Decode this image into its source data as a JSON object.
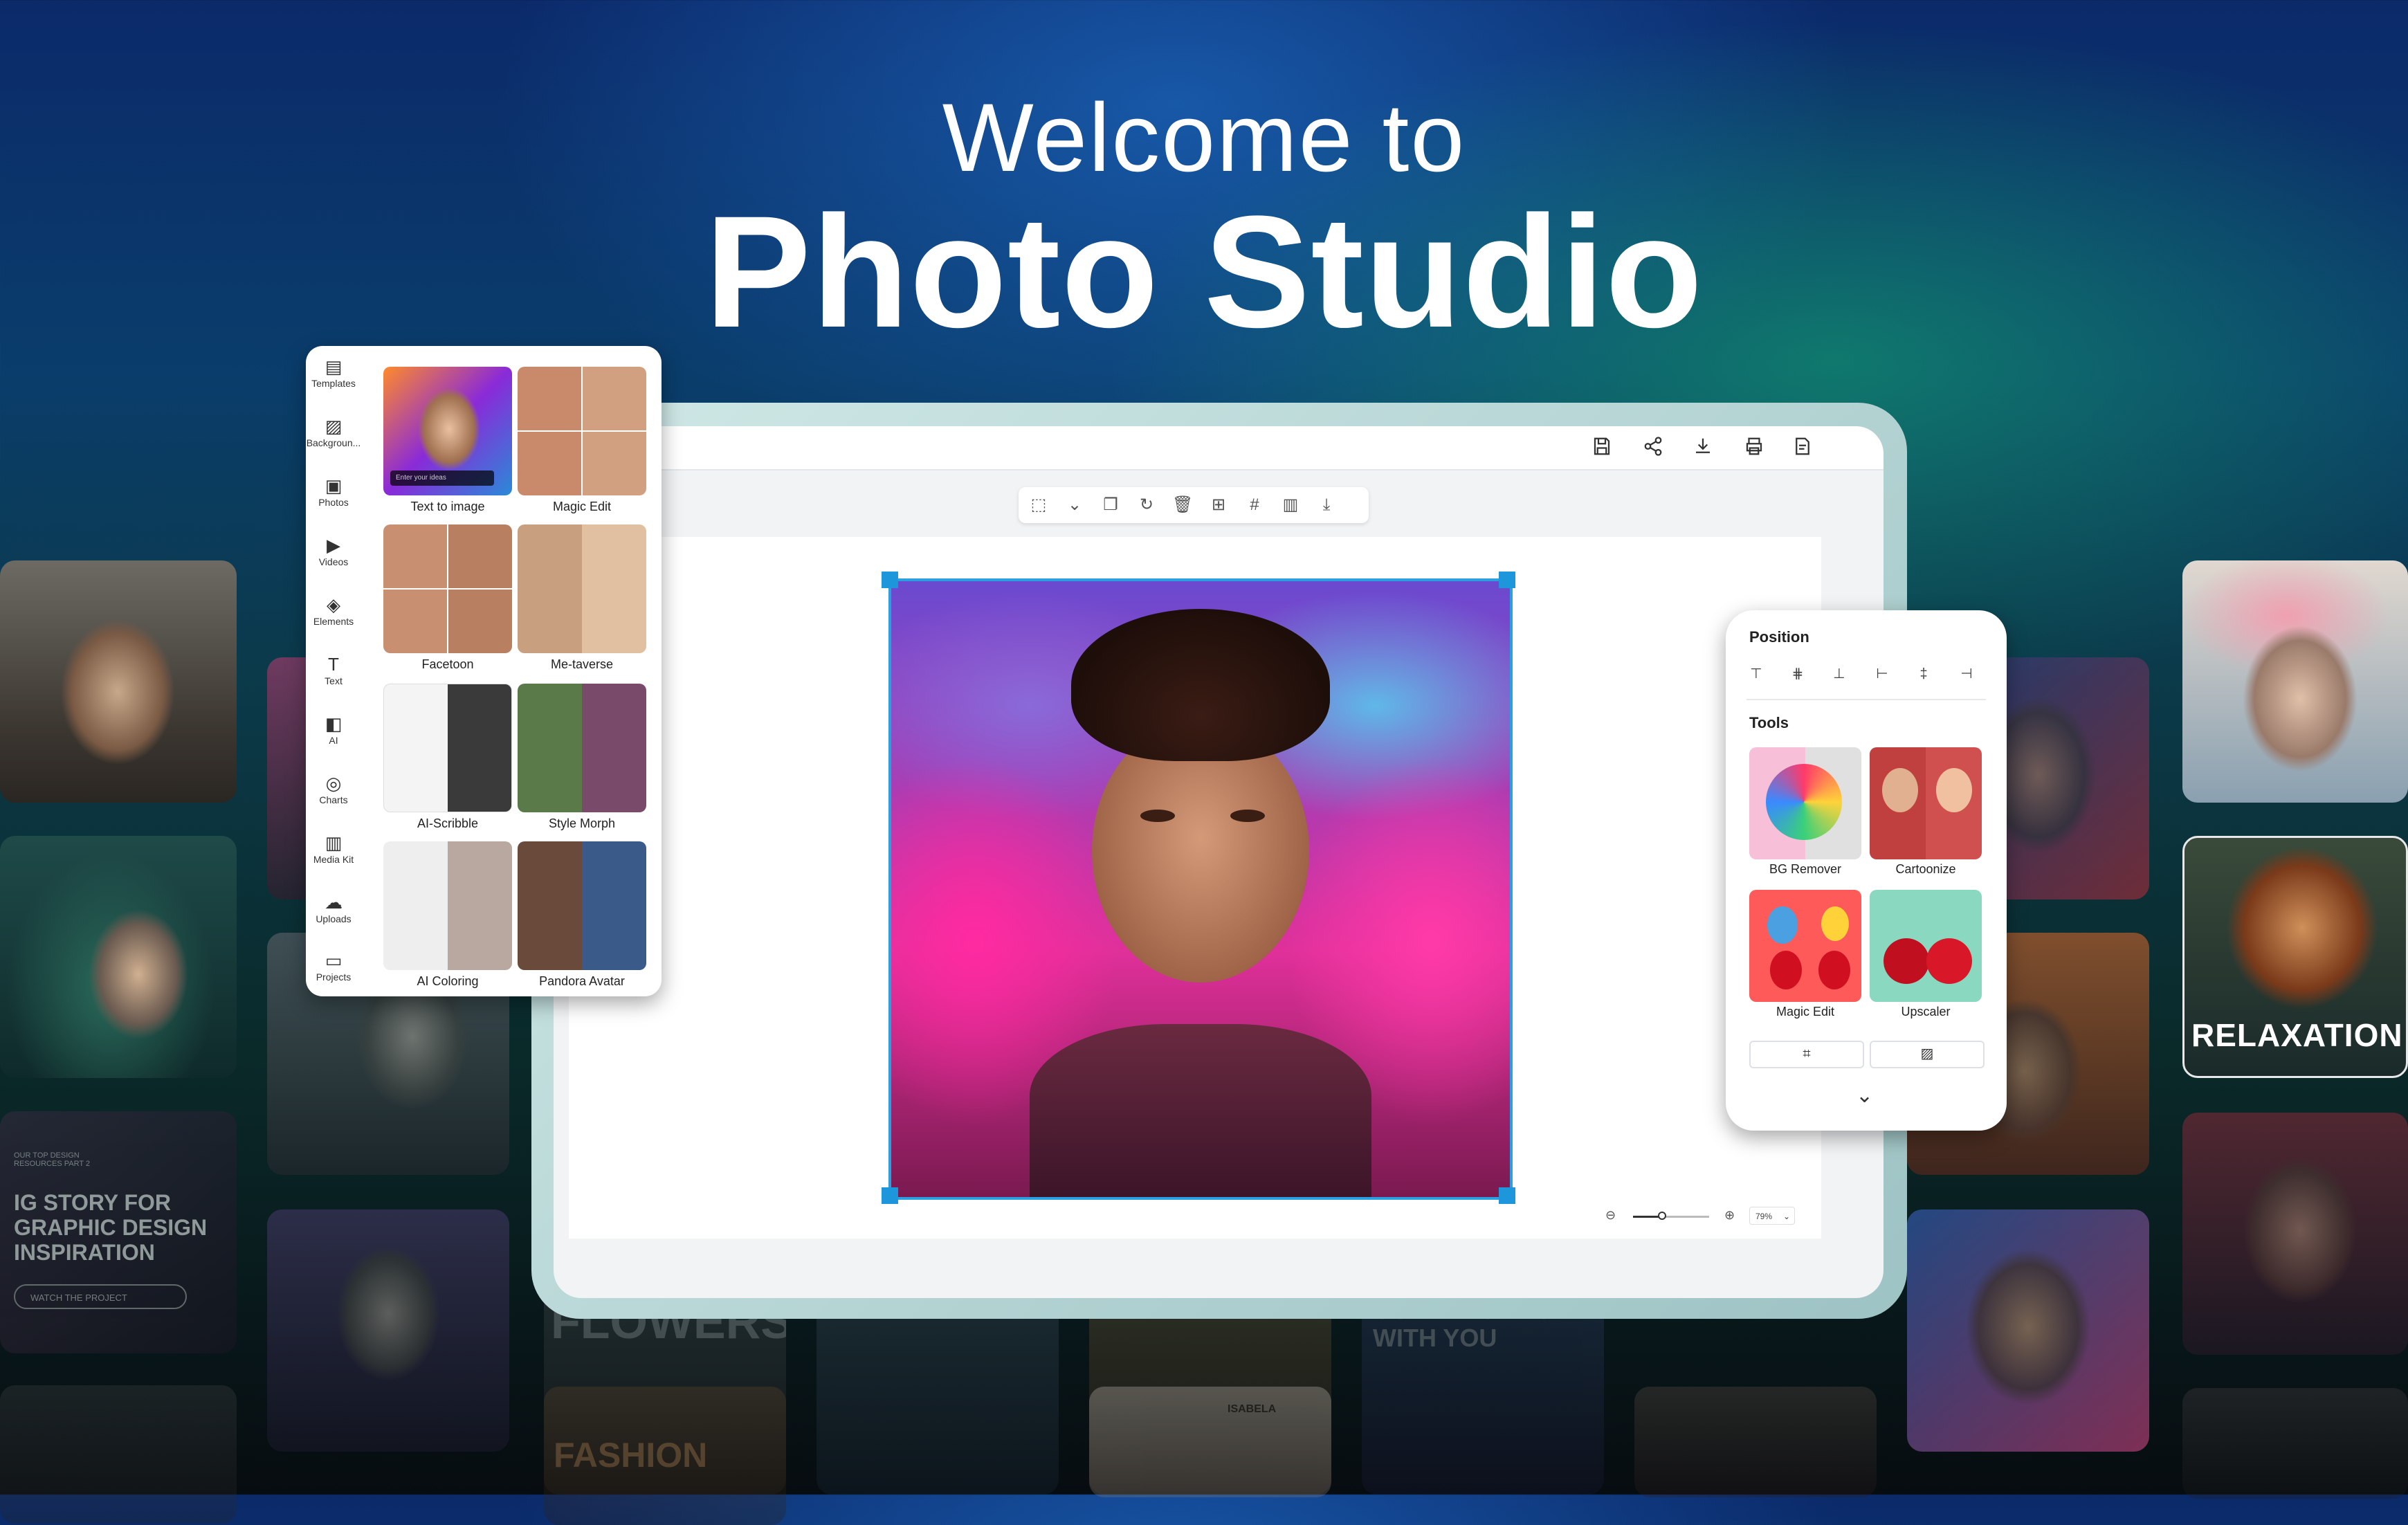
{
  "headline": {
    "line1": "Welcome to",
    "line2": "Photo Studio"
  },
  "bg_cards": {
    "ig_story_kicker": "OUR TOP DESIGN RESOURCES PART 2",
    "ig_story_title": "IG STORY FOR GRAPHIC DESIGN INSPIRATION",
    "ig_story_cta": "WATCH THE PROJECT",
    "relaxation": "RELAXATION",
    "flowers": "FLOWERS",
    "conversation": "CONVERSATION WITH YOU",
    "fashion": "FASHION",
    "isabela": "ISABELA"
  },
  "sidebar": {
    "items": [
      {
        "label": "Templates",
        "icon": "template-icon"
      },
      {
        "label": "Backgroun...",
        "icon": "background-icon"
      },
      {
        "label": "Photos",
        "icon": "photo-icon"
      },
      {
        "label": "Videos",
        "icon": "video-icon"
      },
      {
        "label": "Elements",
        "icon": "elements-icon"
      },
      {
        "label": "Text",
        "icon": "text-icon"
      },
      {
        "label": "AI",
        "icon": "ai-icon"
      },
      {
        "label": "Charts",
        "icon": "chart-icon"
      },
      {
        "label": "Media Kit",
        "icon": "media-kit-icon"
      },
      {
        "label": "Uploads",
        "icon": "upload-icon"
      },
      {
        "label": "Projects",
        "icon": "folder-icon"
      }
    ]
  },
  "ai_tools": {
    "tiles": [
      {
        "label": "Text to image"
      },
      {
        "label": "Magic Edit"
      },
      {
        "label": "Facetoon"
      },
      {
        "label": "Me-taverse"
      },
      {
        "label": "AI-Scribble"
      },
      {
        "label": "Style Morph"
      },
      {
        "label": "AI Coloring"
      },
      {
        "label": "Pandora Avatar"
      }
    ],
    "text_to_image_placeholder": "Enter your ideas"
  },
  "editor": {
    "top_icons": [
      "save-icon",
      "share-icon",
      "download-icon",
      "print-icon",
      "export-icon"
    ],
    "toolbar_icons": [
      "layer-up-icon",
      "layer-down-icon",
      "duplicate-icon",
      "rotate-icon",
      "delete-icon",
      "add-icon",
      "grid-icon",
      "chart-icon",
      "download-icon"
    ],
    "zoom_value": "79%"
  },
  "right_panel": {
    "position_title": "Position",
    "tools_title": "Tools",
    "tools": [
      {
        "label": "BG Remover"
      },
      {
        "label": "Cartoonize"
      },
      {
        "label": "Magic Edit"
      },
      {
        "label": "Upscaler"
      }
    ]
  },
  "colors": {
    "selection": "#1e96dc",
    "panel_bg": "#ffffff"
  }
}
